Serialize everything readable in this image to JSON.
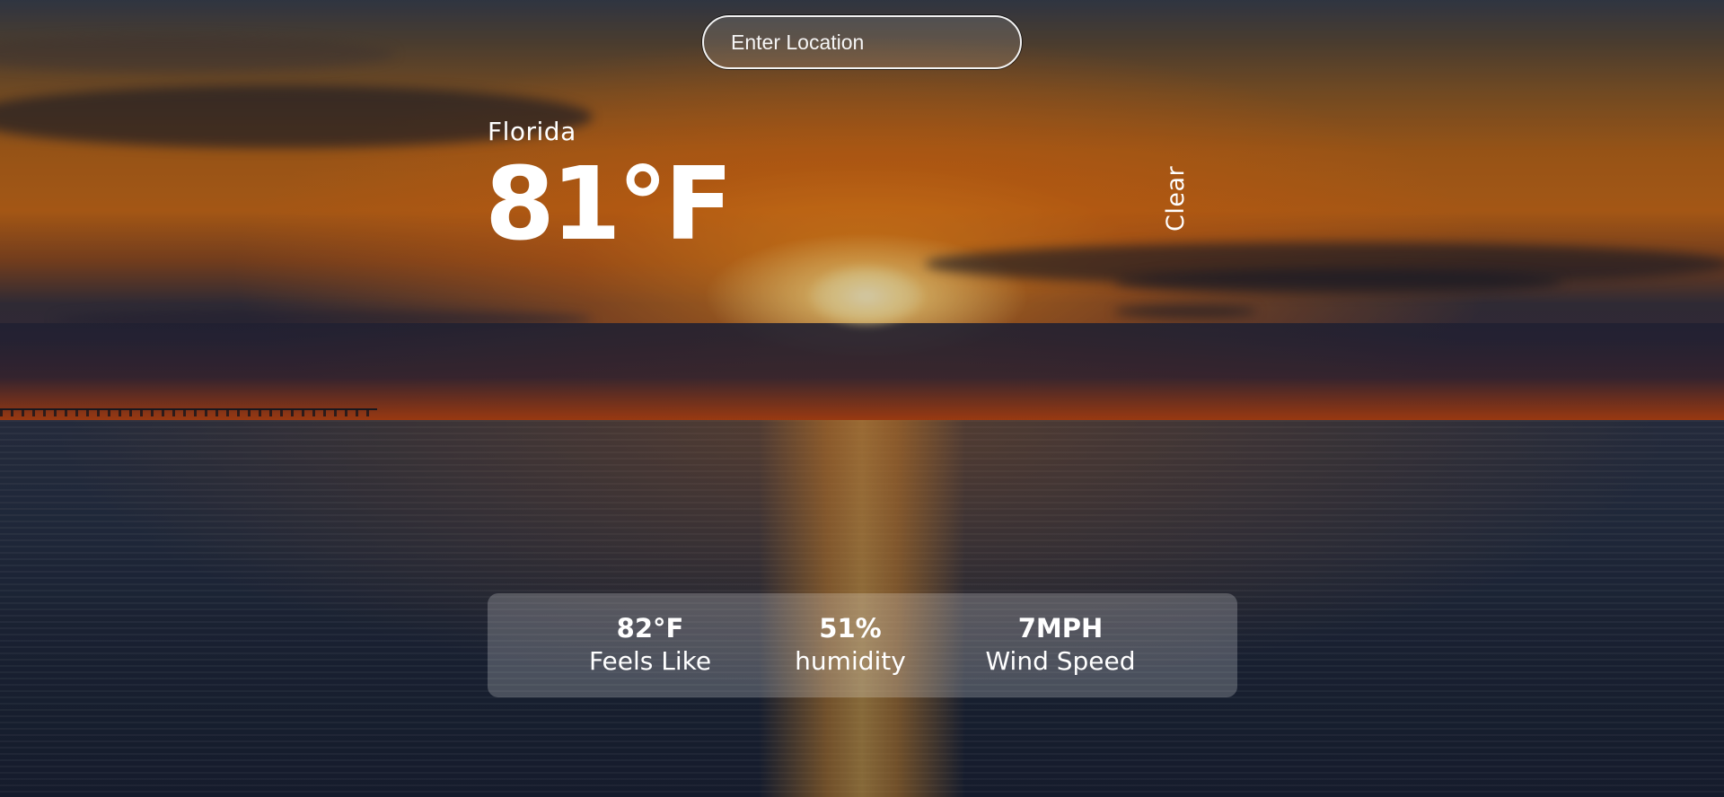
{
  "search": {
    "placeholder": "Enter Location",
    "value": ""
  },
  "weather": {
    "location": "Florida",
    "temperature": "81°F",
    "condition": "Clear"
  },
  "details": [
    {
      "value": "82°F",
      "label": "Feels Like"
    },
    {
      "value": "51%",
      "label": "humidity"
    },
    {
      "value": "7MPH",
      "label": "Wind Speed"
    }
  ]
}
